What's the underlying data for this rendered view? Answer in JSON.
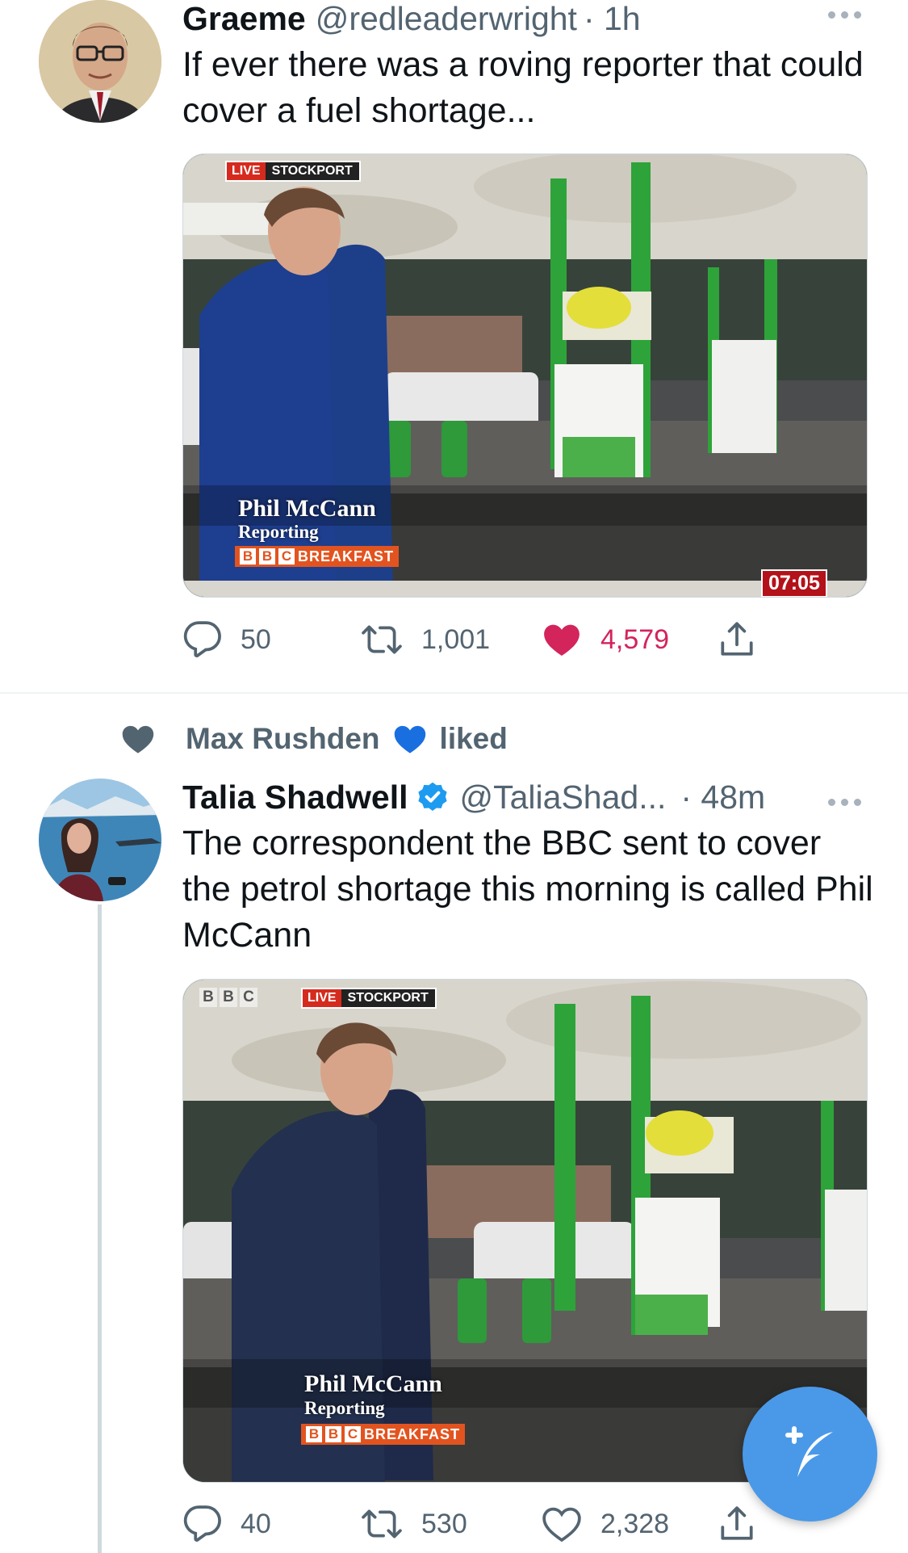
{
  "tweets": [
    {
      "name": "Graeme",
      "handle": "@redleaderwright",
      "time": "· 1h",
      "text": "If ever there was a roving reporter that could cover a fuel shortage...",
      "media": {
        "live_label": "LIVE",
        "location": "STOCKPORT",
        "reporter": "Phil McCann",
        "role": "Reporting",
        "bbc_letters": [
          "B",
          "B",
          "C"
        ],
        "programme": "BREAKFAST",
        "clock": "07:05"
      },
      "actions": {
        "replies": "50",
        "retweets": "1,001",
        "likes": "4,579"
      },
      "liked": true
    },
    {
      "social_context": {
        "liker": "Max Rushden",
        "verb": "liked"
      },
      "name": "Talia Shadwell",
      "verified": true,
      "handle": "@TaliaShad...",
      "time": "· 48m",
      "text": "The correspondent the BBC sent to cover the petrol shortage this morning is called Phil McCann",
      "media": {
        "corner_letters": [
          "B",
          "B",
          "C"
        ],
        "live_label": "LIVE",
        "location": "STOCKPORT",
        "reporter": "Phil McCann",
        "role": "Reporting",
        "bbc_letters": [
          "B",
          "B",
          "C"
        ],
        "programme": "BREAKFAST"
      },
      "actions": {
        "replies": "40",
        "retweets": "530",
        "likes": "2,328"
      },
      "liked": false
    }
  ],
  "colors": {
    "like_active": "#d3245c",
    "secondary_text": "#536471",
    "verified": "#1d9bf0",
    "fab": "#4a99e9",
    "heart_blue_emoji": "#1a6fe0"
  },
  "icons": [
    "reply-icon",
    "retweet-icon",
    "like-icon",
    "share-icon",
    "more-icon",
    "verified-badge-icon",
    "compose-tweet-icon"
  ]
}
